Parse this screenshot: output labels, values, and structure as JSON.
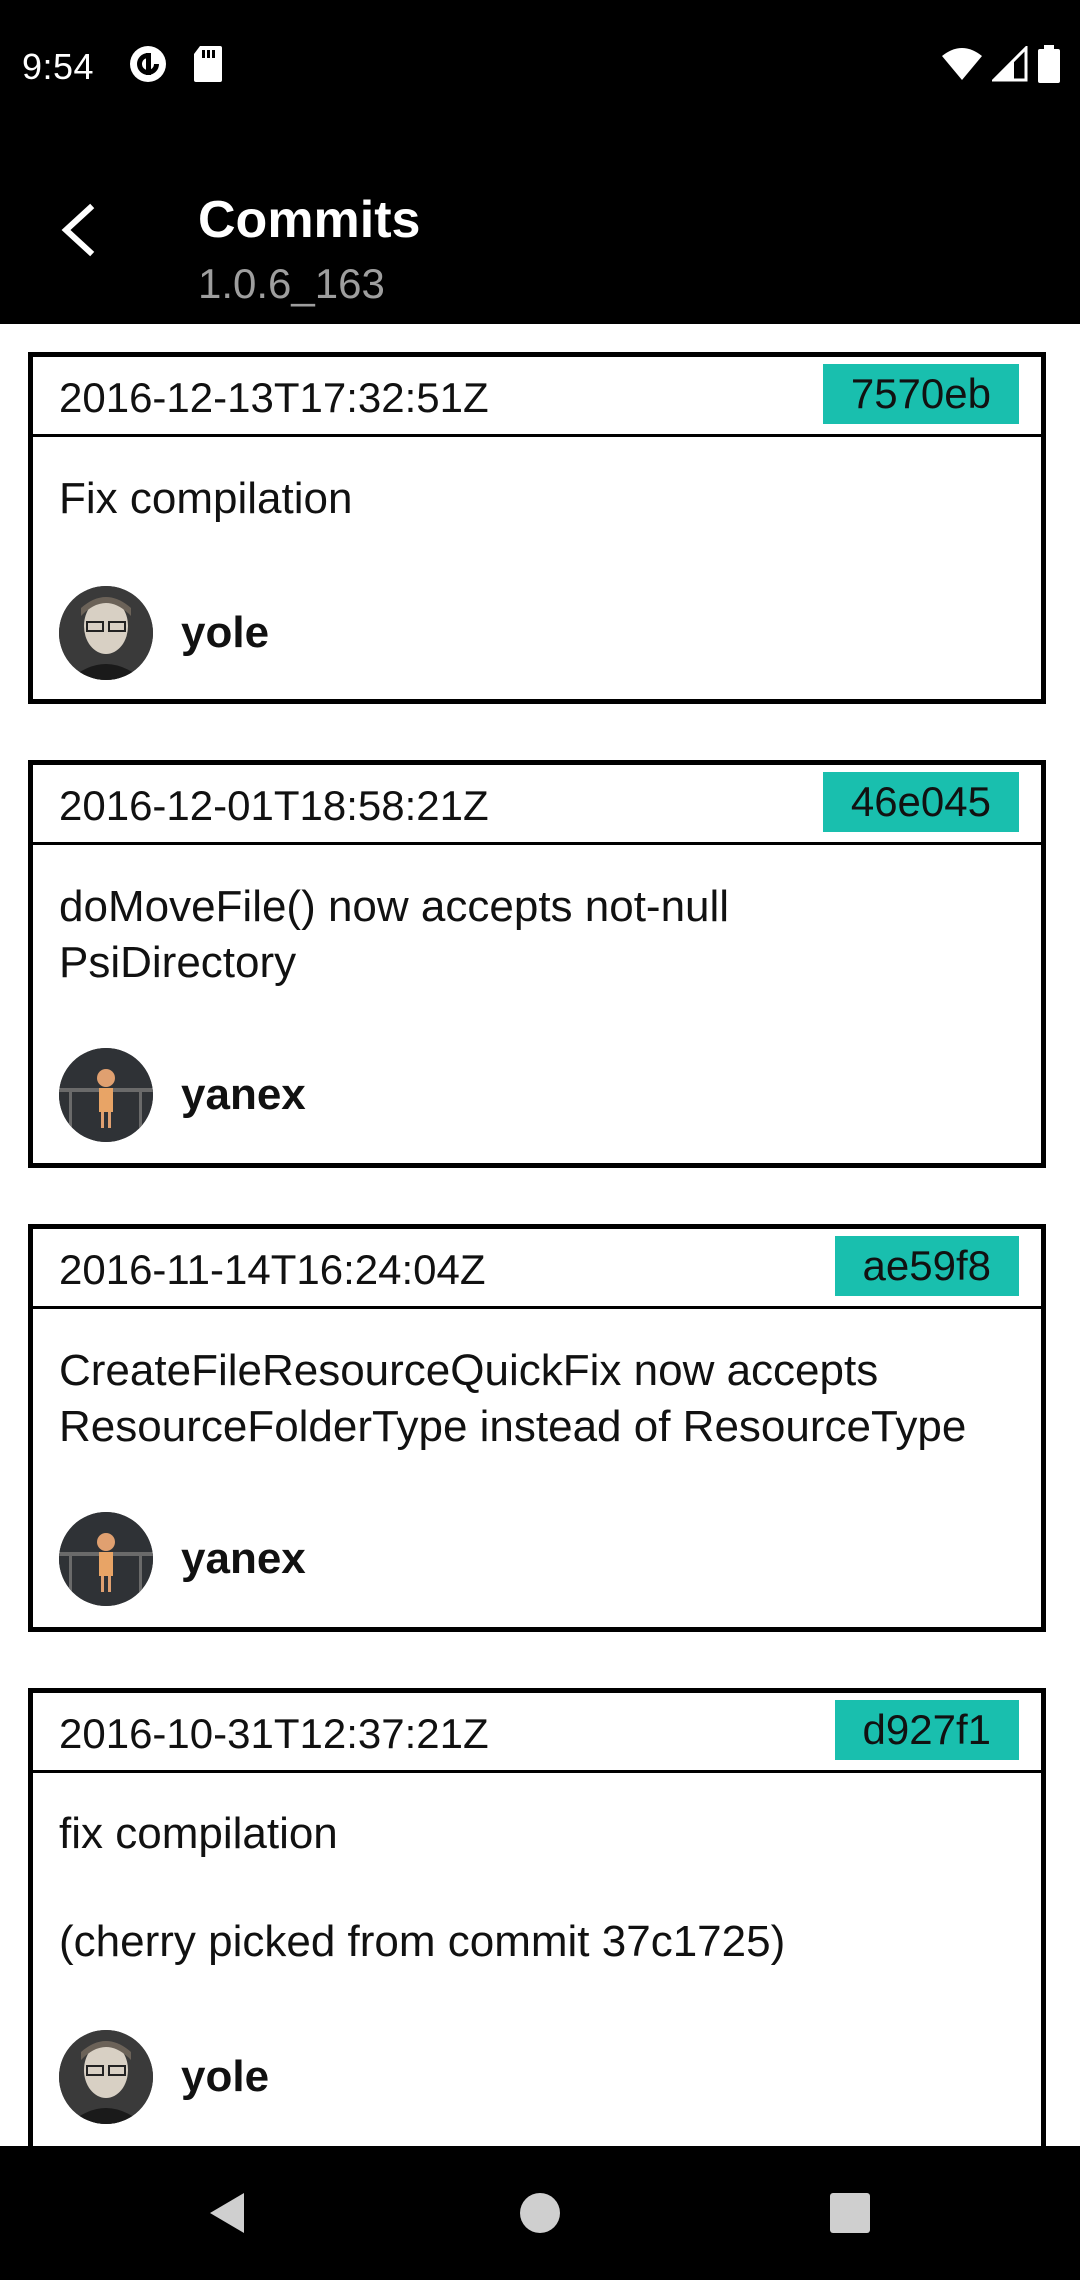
{
  "status_bar": {
    "time": "9:54",
    "left_icons": [
      "pocket-casts-icon",
      "sd-card-icon"
    ],
    "right_icons": [
      "wifi-icon",
      "cell-signal-icon",
      "battery-icon"
    ]
  },
  "app_bar": {
    "title": "Commits",
    "subtitle": "1.0.6_163",
    "back_icon": "back-arrow-icon"
  },
  "colors": {
    "sha_badge": "#19bfae",
    "bar_background": "#000000",
    "subtitle": "#9e9e9e"
  },
  "commits": [
    {
      "date": "2016-12-13T17:32:51Z",
      "sha": "7570eb",
      "message": "Fix compilation",
      "author": "yole",
      "avatar": "man-with-glasses-avatar"
    },
    {
      "date": "2016-12-01T18:58:21Z",
      "sha": "46e045",
      "message": "doMoveFile() now accepts not-null\nPsiDirectory",
      "author": "yanex",
      "avatar": "figure-at-railing-avatar"
    },
    {
      "date": "2016-11-14T16:24:04Z",
      "sha": "ae59f8",
      "message": "CreateFileResourceQuickFix now accepts\nResourceFolderType instead of ResourceType",
      "author": "yanex",
      "avatar": "figure-at-railing-avatar"
    },
    {
      "date": "2016-10-31T12:37:21Z",
      "sha": "d927f1",
      "message": "fix compilation\n\n(cherry picked from commit 37c1725)",
      "author": "yole",
      "avatar": "man-with-glasses-avatar"
    }
  ],
  "nav_bar": {
    "icons": [
      "nav-back-icon",
      "nav-home-icon",
      "nav-recents-icon"
    ]
  }
}
